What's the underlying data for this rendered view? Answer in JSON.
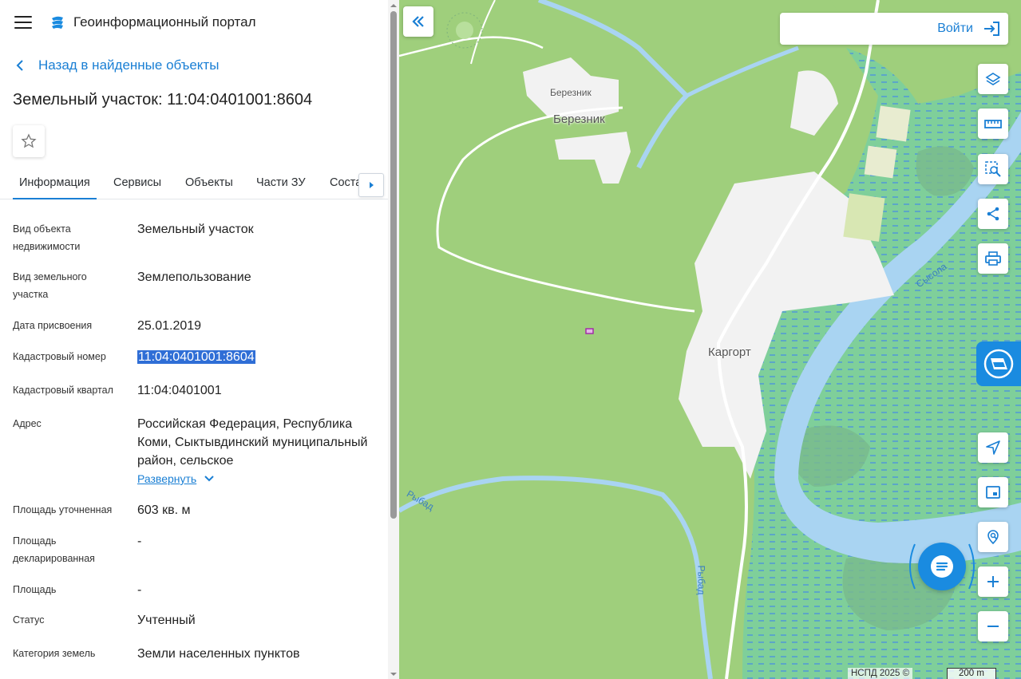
{
  "header": {
    "app_title": "Геоинформационный портал"
  },
  "back_link": "Назад в найденные объекты",
  "page_title": "Земельный участок: 11:04:0401001:8604",
  "tabs": [
    {
      "label": "Информация",
      "active": true
    },
    {
      "label": "Сервисы"
    },
    {
      "label": "Объекты"
    },
    {
      "label": "Части ЗУ"
    },
    {
      "label": "Соста"
    }
  ],
  "properties": [
    {
      "label": "Вид объекта недвижимости",
      "value": "Земельный участок"
    },
    {
      "label": "Вид земельного участка",
      "value": "Землепользование"
    },
    {
      "label": "Дата присвоения",
      "value": "25.01.2019"
    },
    {
      "label": "Кадастровый номер",
      "value": "11:04:0401001:8604"
    },
    {
      "label": "Кадастровый квартал",
      "value": "11:04:0401001"
    },
    {
      "label": "Адрес",
      "value": "Российская Федерация, Республика Коми, Сыктывдинский муниципальный район, сельское"
    },
    {
      "label": "Площадь уточненная",
      "value": "603 кв. м"
    },
    {
      "label": "Площадь декларированная",
      "value": "-"
    },
    {
      "label": "Площадь",
      "value": "-"
    },
    {
      "label": "Статус",
      "value": "Учтенный"
    },
    {
      "label": "Категория земель",
      "value": "Земли населенных пунктов"
    }
  ],
  "expand_link": "Развернуть",
  "map": {
    "login_label": "Войти",
    "labels": {
      "bereznik_small": "Березник",
      "bereznik": "Березник",
      "kargort": "Каргорт"
    },
    "rivers": {
      "sysola": "Сысола",
      "rybad_1": "Рыбад",
      "rybad_2": "Рыбад"
    },
    "attribution": "НСПД 2025 ©",
    "scale": "200 m",
    "tools": [
      "layers-icon",
      "ruler-icon",
      "area-search-icon",
      "share-icon",
      "print-icon",
      "locate-icon",
      "minimap-icon",
      "geo-search-icon",
      "zoom-in-icon",
      "zoom-out-icon"
    ]
  },
  "colors": {
    "accent": "#1a7fd4",
    "selection": "#2f6ed6",
    "map_green": "#9fcf7c",
    "water": "#a9d4f2"
  }
}
